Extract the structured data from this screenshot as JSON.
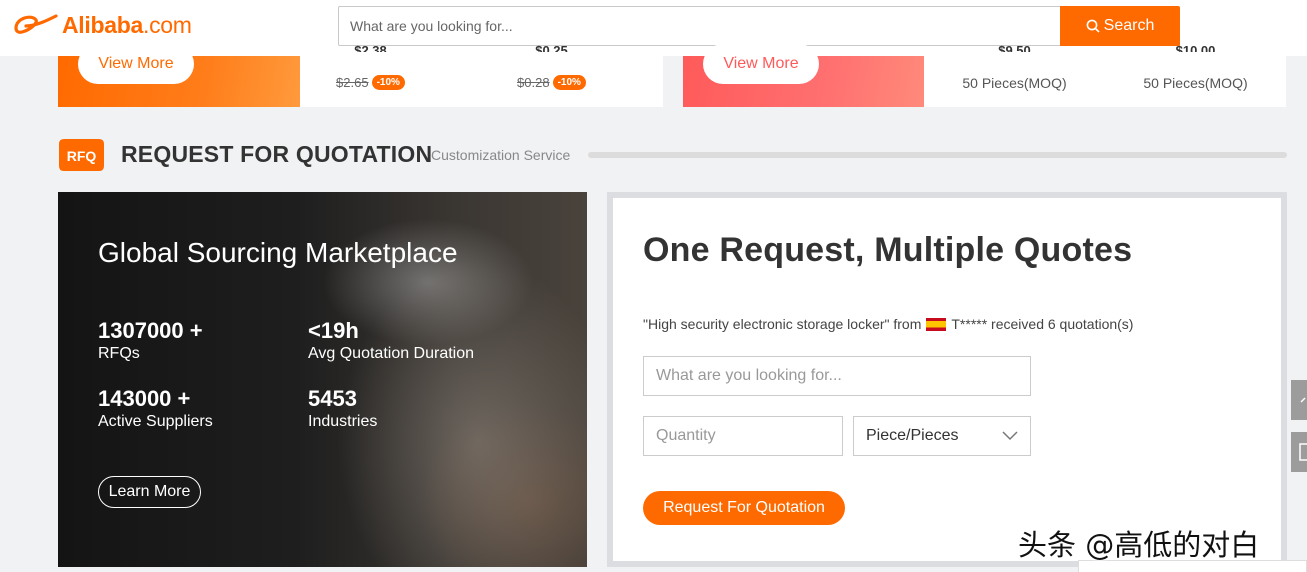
{
  "header": {
    "logo_brand": "Alibaba",
    "logo_suffix": ".com",
    "search_placeholder": "What are you looking for...",
    "search_button": "Search"
  },
  "promos": {
    "left": {
      "view_more": "View More",
      "products": [
        {
          "price": "$2.38",
          "old_price": "$2.65",
          "discount": "-10%"
        },
        {
          "price": "$0.25",
          "old_price": "$0.28",
          "discount": "-10%"
        }
      ]
    },
    "right": {
      "view_more": "View More",
      "products": [
        {
          "price": "$9.50",
          "moq": "50 Pieces(MOQ)"
        },
        {
          "price": "$10.00",
          "moq": "50 Pieces(MOQ)"
        }
      ]
    }
  },
  "rfq_section": {
    "badge": "RFQ",
    "title": "REQUEST FOR QUOTATION",
    "subtitle": "Customization Service"
  },
  "marketplace": {
    "title": "Global Sourcing Marketplace",
    "stats": [
      {
        "value": "1307000 +",
        "label": "RFQs"
      },
      {
        "value": "<19h",
        "label": "Avg Quotation Duration"
      },
      {
        "value": "143000 +",
        "label": "Active Suppliers"
      },
      {
        "value": "5453",
        "label": "Industries"
      }
    ],
    "learn_more": "Learn More"
  },
  "quote_form": {
    "title": "One Request, Multiple Quotes",
    "ticker_product": "\"High security electronic storage locker\" from",
    "ticker_rest": "T***** received 6 quotation(s)",
    "product_placeholder": "What are you looking for...",
    "quantity_placeholder": "Quantity",
    "unit_selected": "Piece/Pieces",
    "submit": "Request For Quotation"
  },
  "watermark": "头条 @高低的对白",
  "colors": {
    "accent": "#ff6a00",
    "pink": "#ff5a5a",
    "dark_panel": "#1e1e1e"
  }
}
